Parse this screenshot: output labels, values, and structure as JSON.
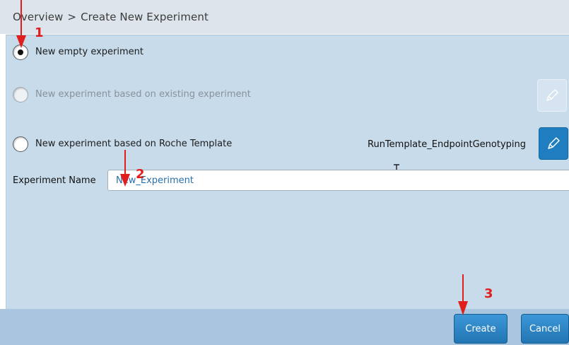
{
  "breadcrumb": {
    "root": "Overview",
    "separator": ">",
    "current": "Create New Experiment"
  },
  "options": [
    {
      "label": "New empty experiment",
      "selected": true,
      "enabled": true
    },
    {
      "label": "New experiment based on existing experiment",
      "selected": false,
      "enabled": false
    },
    {
      "label": "New experiment based on Roche Template",
      "selected": false,
      "enabled": true
    }
  ],
  "template": {
    "name": "RunTemplate_EndpointGenotyping"
  },
  "experiment_name": {
    "label": "Experiment Name",
    "value": "New_Experiment"
  },
  "footer": {
    "create_label": "Create",
    "cancel_label": "Cancel"
  },
  "annotations": {
    "step1": "1",
    "step2": "2",
    "step3": "3"
  },
  "icons": {
    "edit": "pencil-icon",
    "text_cursor": "i-beam-cursor-icon"
  },
  "colors": {
    "accent": "#1e7ec0",
    "annotation": "#e01e1e",
    "panel": "#c8dbea",
    "footer": "#a9c6de",
    "header": "#dde4ec",
    "input_text": "#2a6fa8"
  }
}
